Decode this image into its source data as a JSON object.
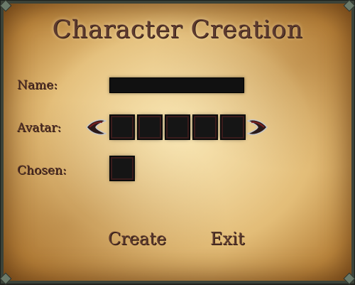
{
  "title": "Character Creation",
  "labels": {
    "name": "Name:",
    "avatar": "Avatar:",
    "chosen": "Chosen:"
  },
  "name_field": {
    "value": ""
  },
  "avatar_slot_count": 5,
  "buttons": {
    "create": "Create",
    "exit": "Exit"
  },
  "icons": {
    "prev": "left-arrow-icon",
    "next": "right-arrow-icon"
  },
  "colors": {
    "parchment": "#e3bd78",
    "text": "#5e3b2f",
    "slot": "#151515",
    "frame": "#3b4238"
  }
}
